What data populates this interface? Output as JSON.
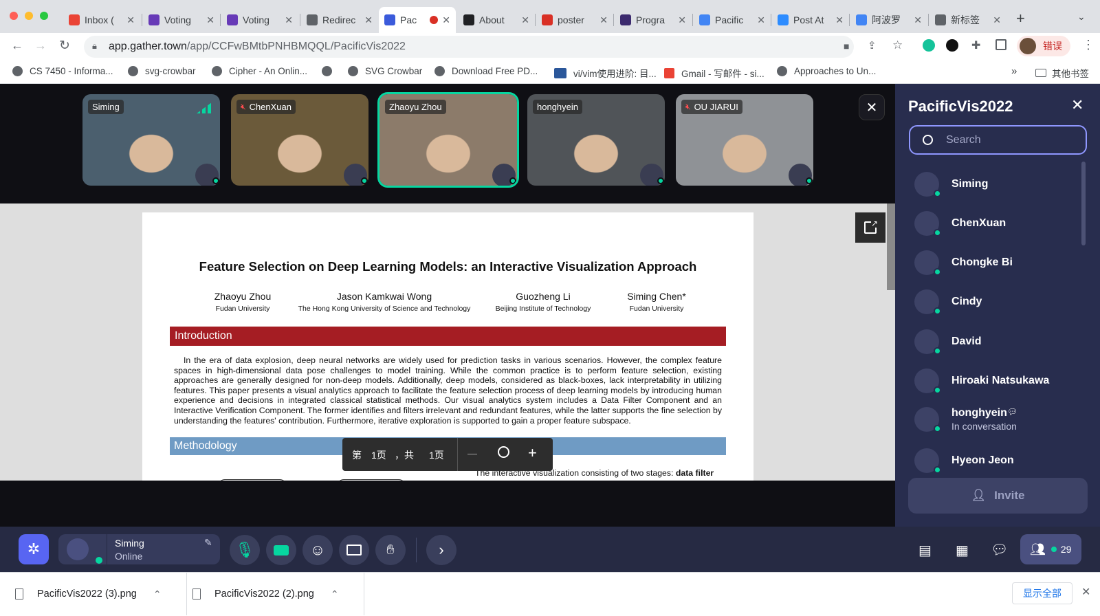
{
  "browser": {
    "tabs": [
      {
        "title": "Inbox (",
        "favicon": "gmail-icon",
        "color": "#ea4335"
      },
      {
        "title": "Voting",
        "favicon": "forms-icon",
        "color": "#673ab7"
      },
      {
        "title": "Voting",
        "favicon": "forms-icon",
        "color": "#673ab7"
      },
      {
        "title": "Redirec",
        "favicon": "globe-icon",
        "color": "#5f6368"
      },
      {
        "title": "Pac",
        "favicon": "gather-icon",
        "color": "#3b5bdb",
        "active": true
      },
      {
        "title": "About",
        "favicon": "code-icon",
        "color": "#202124"
      },
      {
        "title": "poster",
        "favicon": "poster-icon",
        "color": "#d93025"
      },
      {
        "title": "Progra",
        "favicon": "pv-icon",
        "color": "#3c2a6e"
      },
      {
        "title": "Pacific",
        "favicon": "docs-icon",
        "color": "#4285f4"
      },
      {
        "title": "Post At",
        "favicon": "zoom-icon",
        "color": "#2d8cff"
      },
      {
        "title": "阿波罗",
        "favicon": "google-icon",
        "color": "#4285f4"
      },
      {
        "title": "新标签",
        "favicon": "chrome-icon",
        "color": "#5f6368"
      }
    ],
    "url_domain": "app.gather.town",
    "url_path": "/app/CCFwBMtbPNHBMQQL/PacificVis2022",
    "profile_label": "错误",
    "bookmarks": [
      "CS 7450 - Informa...",
      "svg-crowbar",
      "Cipher - An Onlin...",
      "",
      "SVG Crowbar",
      "Download Free PD...",
      "vi/vim使用进阶: 目...",
      "Gmail - 写邮件 - si...",
      "Approaches to Un..."
    ],
    "bookmarks_more": "»",
    "other_bookmarks": "其他书签"
  },
  "video_tiles": [
    {
      "name": "Siming",
      "muted": false,
      "bg": "#4b5f6e"
    },
    {
      "name": "ChenXuan",
      "muted": true,
      "bg": "#6b5a3a"
    },
    {
      "name": "Zhaoyu Zhou",
      "muted": false,
      "bg": "#8c7b6a",
      "highlight": true
    },
    {
      "name": "honghyein",
      "muted": false,
      "bg": "#505458"
    },
    {
      "name": "OU JIARUI",
      "muted": true,
      "bg": "#8f9296"
    }
  ],
  "paper": {
    "title": "Feature Selection on Deep Learning Models: an Interactive Visualization Approach",
    "authors": [
      {
        "name": "Zhaoyu Zhou",
        "affil": "Fudan University"
      },
      {
        "name": "Jason Kamkwai Wong",
        "affil": "The Hong Kong University of Science and Technology"
      },
      {
        "name": "Guozheng Li",
        "affil": "Beijing Institute of Technology"
      },
      {
        "name": "Siming Chen*",
        "affil": "Fudan University"
      }
    ],
    "intro_heading": "Introduction",
    "intro_text": "In the era of data explosion, deep neural networks are widely used for prediction tasks in various scenarios. However, the complex feature spaces in high-dimensional data pose challenges to model training. While the common practice is to perform feature selection, existing approaches are generally designed for non-deep models. Additionally, deep models, considered as black-boxes, lack interpretability in utilizing features. This paper presents a visual analytics approach to facilitate the feature selection process of deep learning models by introducing human experience and decisions in integrated classical statistical methods. Our visual analytics system includes a Data Filter Component and an Interactive Verification Component. The former identifies and filters irrelevant and redundant features, while the latter supports the fine selection by understanding the features' contribution. Furthermore, iterative exploration is supported to gain a proper feature subspace.",
    "method_heading": "Methodology",
    "method_text_start": "The interactive visualization consisting of two stages: ",
    "method_text_bold": "data filter"
  },
  "pdf_toolbar": {
    "page_label_prefix": "第",
    "page_current": "1页",
    "page_sep": "，共",
    "page_total": "1页",
    "zoom_out": "—",
    "zoom_in": "+"
  },
  "sidebar": {
    "title": "PacificVis2022",
    "search_placeholder": "Search",
    "people": [
      {
        "name": "Siming",
        "status": ""
      },
      {
        "name": "ChenXuan",
        "status": ""
      },
      {
        "name": "Chongke Bi",
        "status": ""
      },
      {
        "name": "Cindy",
        "status": ""
      },
      {
        "name": "David",
        "status": ""
      },
      {
        "name": "Hiroaki Natsukawa",
        "status": ""
      },
      {
        "name": "honghyein",
        "status": "In conversation"
      },
      {
        "name": "Hyeon Jeon",
        "status": ""
      }
    ],
    "invite_label": "Invite"
  },
  "bottombar": {
    "user_name": "Siming",
    "user_status": "Online",
    "participant_count": "29"
  },
  "downloads": {
    "files": [
      "PacificVis2022 (3).png",
      "PacificVis2022 (2).png"
    ],
    "show_all": "显示全部"
  },
  "colors": {
    "gather_bg": "#282d4e",
    "accent_green": "#06d6a0",
    "intro_bar": "#a51d23",
    "method_bar": "#6f9bc4"
  }
}
